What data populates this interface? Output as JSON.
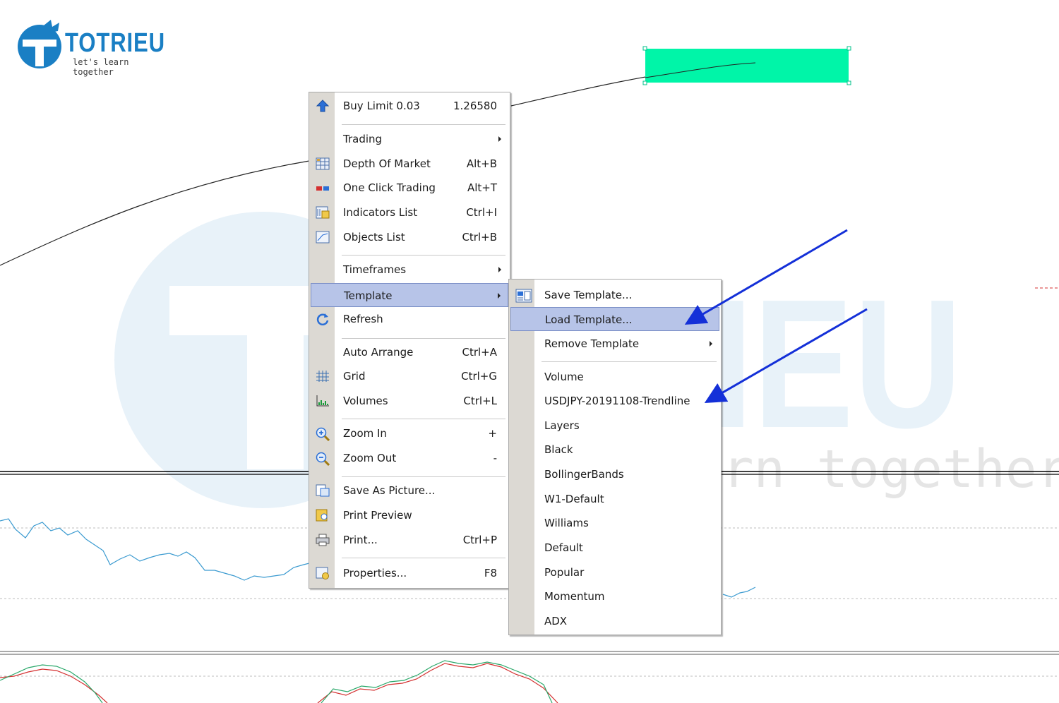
{
  "logo": {
    "name": "TOTRIEU",
    "tagline": "let's learn together"
  },
  "watermark": {
    "text": "let's learn together"
  },
  "context_menu": {
    "items": [
      {
        "label": "Buy Limit 0.03",
        "shortcut": "1.26580",
        "icon": "buy-limit-arrow-icon"
      },
      {
        "label": "Trading",
        "shortcut": "",
        "submenu": true
      },
      {
        "label": "Depth Of Market",
        "shortcut": "Alt+B",
        "icon": "depth-of-market-icon"
      },
      {
        "label": "One Click Trading",
        "shortcut": "Alt+T",
        "icon": "one-click-trading-icon"
      },
      {
        "label": "Indicators List",
        "shortcut": "Ctrl+I",
        "icon": "indicators-list-icon"
      },
      {
        "label": "Objects List",
        "shortcut": "Ctrl+B",
        "icon": "objects-list-icon"
      },
      {
        "label": "Timeframes",
        "shortcut": "",
        "submenu": true
      },
      {
        "label": "Template",
        "shortcut": "",
        "submenu": true,
        "highlighted": true
      },
      {
        "label": "Refresh",
        "shortcut": "",
        "icon": "refresh-icon"
      },
      {
        "label": "Auto Arrange",
        "shortcut": "Ctrl+A"
      },
      {
        "label": "Grid",
        "shortcut": "Ctrl+G",
        "icon": "grid-icon"
      },
      {
        "label": "Volumes",
        "shortcut": "Ctrl+L",
        "icon": "volumes-icon"
      },
      {
        "label": "Zoom In",
        "shortcut": "+",
        "icon": "zoom-in-icon"
      },
      {
        "label": "Zoom Out",
        "shortcut": "-",
        "icon": "zoom-out-icon"
      },
      {
        "label": "Save As Picture...",
        "shortcut": "",
        "icon": "save-picture-icon"
      },
      {
        "label": "Print Preview",
        "shortcut": "",
        "icon": "print-preview-icon"
      },
      {
        "label": "Print...",
        "shortcut": "Ctrl+P",
        "icon": "print-icon"
      },
      {
        "label": "Properties...",
        "shortcut": "F8",
        "icon": "properties-icon"
      }
    ]
  },
  "template_submenu": {
    "items": [
      {
        "label": "Save Template...",
        "icon": "save-template-icon"
      },
      {
        "label": "Load Template...",
        "highlighted": true
      },
      {
        "label": "Remove Template",
        "submenu": true
      },
      {
        "label": "Volume"
      },
      {
        "label": "USDJPY-20191108-Trendline"
      },
      {
        "label": "Layers"
      },
      {
        "label": "Black"
      },
      {
        "label": "BollingerBands"
      },
      {
        "label": "W1-Default"
      },
      {
        "label": "Williams"
      },
      {
        "label": "Default"
      },
      {
        "label": "Popular"
      },
      {
        "label": "Momentum"
      },
      {
        "label": "ADX"
      }
    ]
  },
  "colors": {
    "highlight": "#b7c4e8",
    "annotation_arrow": "#1430d8",
    "selection_rect": "#00f5a8",
    "indicator_line": "#3a9ad0",
    "oscillator_red": "#d43030",
    "oscillator_green": "#2aa86a"
  }
}
